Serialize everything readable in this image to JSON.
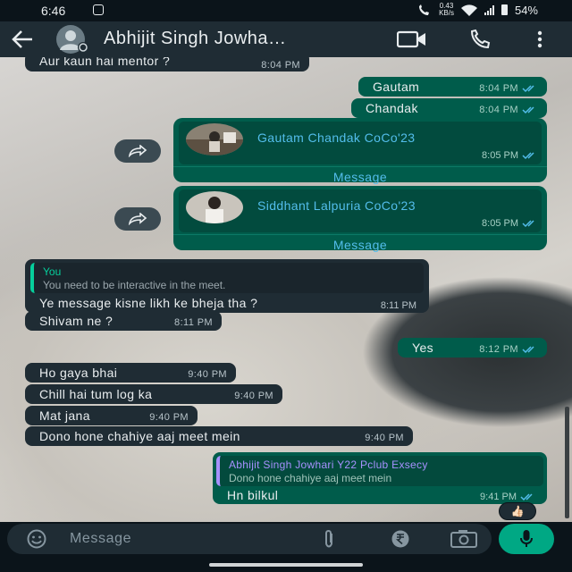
{
  "status_bar": {
    "time": "6:46",
    "net_speed_value": "0.43",
    "net_speed_unit": "KB/s",
    "battery": "54%"
  },
  "header": {
    "contact_name": "Abhijit Singh Jowha…"
  },
  "messages": {
    "m0": {
      "text": "Aur kaun hai mentor ?",
      "time": "8:04 PM"
    },
    "m1": {
      "text": "Gautam",
      "time": "8:04 PM"
    },
    "m2": {
      "text": "Chandak",
      "time": "8:04 PM"
    },
    "card1": {
      "name": "Gautam Chandak CoCo'23",
      "time": "8:05 PM",
      "action": "Message"
    },
    "card2": {
      "name": "Siddhant Lalpuria CoCo'23",
      "time": "8:05 PM",
      "action": "Message"
    },
    "quote1": {
      "author": "You",
      "quoted": "You need to be interactive in the meet.",
      "text": "Ye message kisne likh ke bheja tha ?",
      "time": "8:11 PM"
    },
    "m3": {
      "text": "Shivam ne ?",
      "time": "8:11 PM"
    },
    "m4": {
      "text": "Yes",
      "time": "8:12 PM"
    },
    "m5": {
      "text": "Ho gaya bhai",
      "time": "9:40 PM"
    },
    "m6": {
      "text": "Chill hai tum log ka",
      "time": "9:40 PM"
    },
    "m7": {
      "text": "Mat jana",
      "time": "9:40 PM"
    },
    "m8": {
      "text": "Dono hone chahiye aaj meet mein",
      "time": "9:40 PM"
    },
    "quote2": {
      "author": "Abhijit Singh Jowhari Y22 Pclub Exsecy",
      "quoted": "Dono hone chahiye aaj meet mein",
      "text": "Hn bilkul",
      "time": "9:41 PM"
    },
    "reaction": "👍🏻"
  },
  "input": {
    "placeholder": "Message"
  },
  "colors": {
    "incoming_bubble": "#1f2c34",
    "outgoing_bubble": "#005c4b",
    "accent_green": "#00a884",
    "read_ticks": "#53bdeb"
  },
  "icons": {
    "back": "arrow-left-icon",
    "video": "video-camera-icon",
    "call": "phone-icon",
    "menu": "more-vertical-icon",
    "forward": "forward-icon",
    "emoji": "emoji-icon",
    "attach": "paperclip-icon",
    "payment": "rupee-icon",
    "camera": "camera-icon",
    "mic": "microphone-icon"
  }
}
